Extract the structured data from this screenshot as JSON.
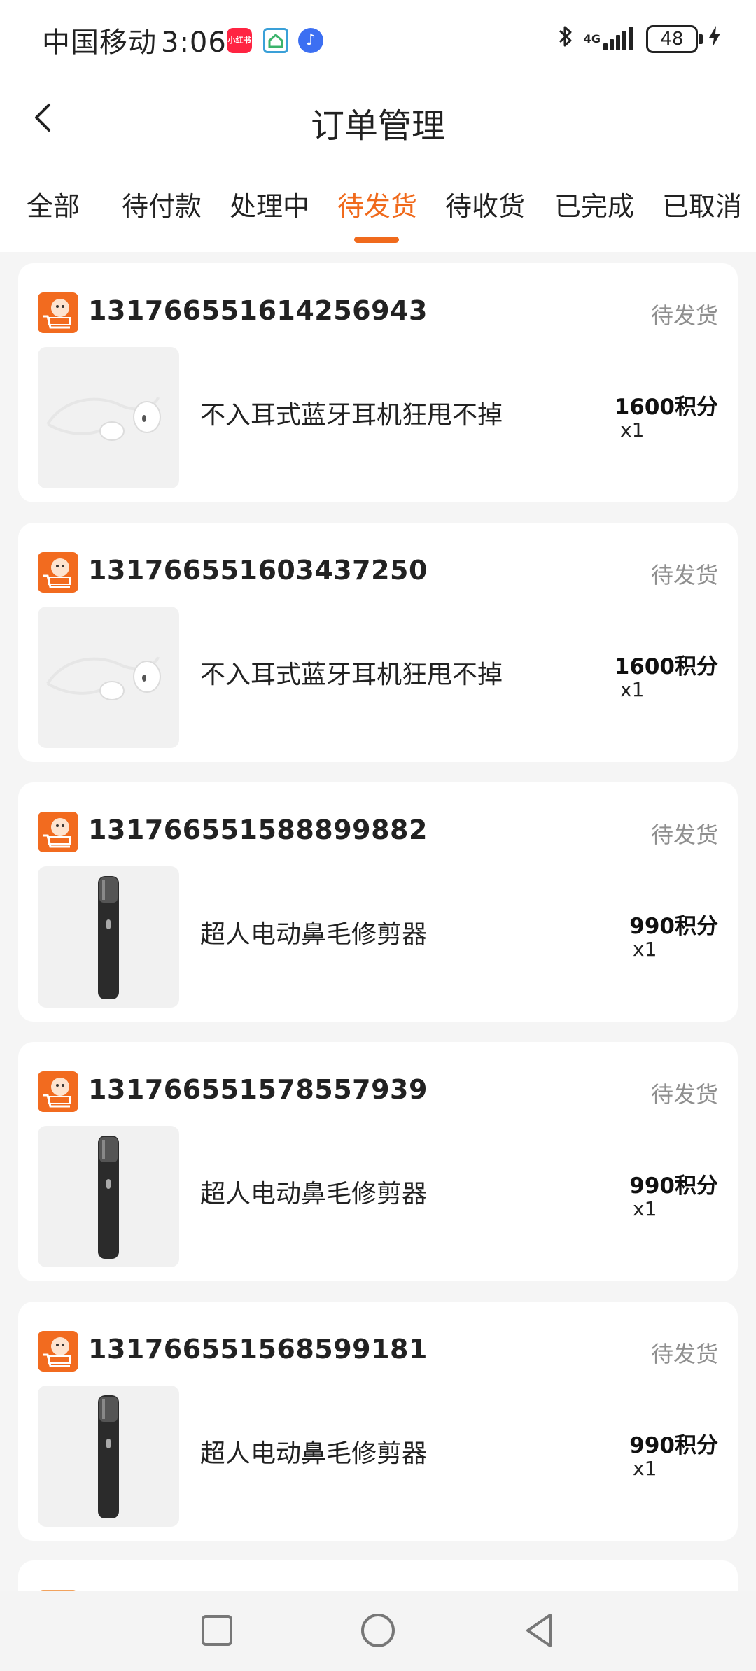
{
  "status_bar": {
    "carrier": "中国移动",
    "time": "3:06",
    "app_badge_label": "小红书",
    "network": "4G",
    "battery": "48",
    "icons": [
      "xiaohongshu-icon",
      "home-app-icon",
      "music-app-icon",
      "bluetooth-icon",
      "signal-icon",
      "battery-icon",
      "charging-icon"
    ]
  },
  "header": {
    "title": "订单管理",
    "back_icon": "chevron-left-icon"
  },
  "tabs": [
    {
      "label": "全部",
      "active": false
    },
    {
      "label": "待付款",
      "active": false
    },
    {
      "label": "处理中",
      "active": false
    },
    {
      "label": "待发货",
      "active": true
    },
    {
      "label": "待收货",
      "active": false
    },
    {
      "label": "已完成",
      "active": false
    },
    {
      "label": "已取消",
      "active": false
    }
  ],
  "orders": [
    {
      "order_no": "131766551614256943",
      "status": "待发货",
      "product": "不入耳式蓝牙耳机狂甩不掉",
      "price": "1600积分",
      "qty": "x1",
      "image": "earphones"
    },
    {
      "order_no": "131766551603437250",
      "status": "待发货",
      "product": "不入耳式蓝牙耳机狂甩不掉",
      "price": "1600积分",
      "qty": "x1",
      "image": "earphones"
    },
    {
      "order_no": "131766551588899882",
      "status": "待发货",
      "product": "超人电动鼻毛修剪器",
      "price": "990积分",
      "qty": "x1",
      "image": "trimmer"
    },
    {
      "order_no": "131766551578557939",
      "status": "待发货",
      "product": "超人电动鼻毛修剪器",
      "price": "990积分",
      "qty": "x1",
      "image": "trimmer"
    },
    {
      "order_no": "131766551568599181",
      "status": "待发货",
      "product": "超人电动鼻毛修剪器",
      "price": "990积分",
      "qty": "x1",
      "image": "trimmer"
    }
  ],
  "colors": {
    "accent": "#f06a1c",
    "status_gray": "#8f8f8f",
    "background": "#f5f5f5",
    "card": "#ffffff"
  },
  "bottom_nav": {
    "icons": [
      "recent-apps-icon",
      "home-icon",
      "back-triangle-icon"
    ]
  }
}
